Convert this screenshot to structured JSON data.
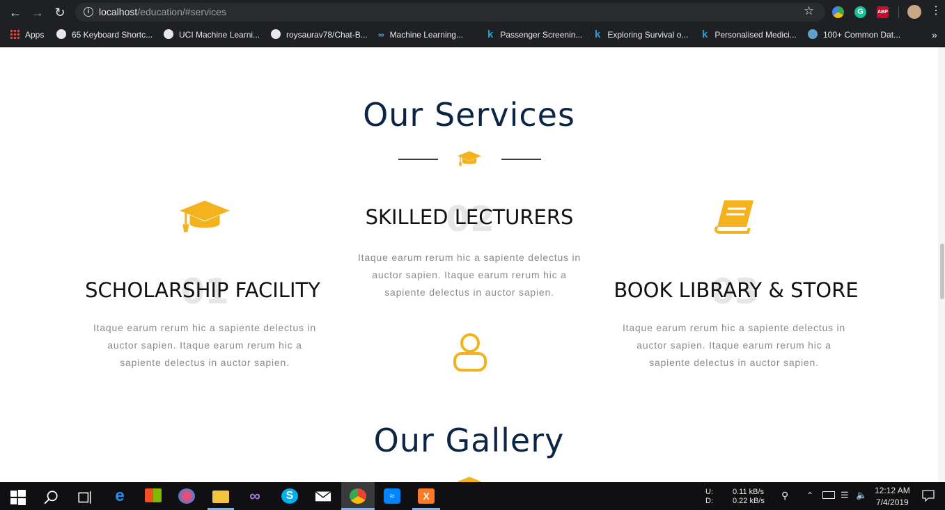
{
  "browser": {
    "url_host": "localhost",
    "url_path": "/education/#services",
    "bookmarks": [
      {
        "label": "Apps"
      },
      {
        "label": "65 Keyboard Shortc..."
      },
      {
        "label": "UCI Machine Learni..."
      },
      {
        "label": "roysaurav78/Chat-B..."
      },
      {
        "label": "Machine Learning..."
      },
      {
        "label": "Passenger Screenin..."
      },
      {
        "label": "Exploring Survival o..."
      },
      {
        "label": "Personalised Medici..."
      },
      {
        "label": "100+ Common Dat..."
      }
    ],
    "more_glyph": "»"
  },
  "services": {
    "title": "Our Services",
    "items": [
      {
        "number": "01",
        "title": "SCHOLARSHIP FACILITY",
        "text": "Itaque earum rerum hic a sapiente delectus in auctor sapien. Itaque earum rerum hic a sapiente delectus in auctor sapien.",
        "icon": "graduation-cap-icon"
      },
      {
        "number": "02",
        "title": "SKILLED LECTURERS",
        "text": "Itaque earum rerum hic a sapiente delectus in auctor sapien. Itaque earum rerum hic a sapiente delectus in auctor sapien.",
        "icon": "user-icon"
      },
      {
        "number": "03",
        "title": "BOOK LIBRARY & STORE",
        "text": "Itaque earum rerum hic a sapiente delectus in auctor sapien. Itaque earum rerum hic a sapiente delectus in auctor sapien.",
        "icon": "book-icon"
      }
    ]
  },
  "gallery": {
    "title": "Our Gallery"
  },
  "taskbar": {
    "net_up_label": "U:",
    "net_down_label": "D:",
    "net_up": "0.11 kB/s",
    "net_down": "0.22 kB/s",
    "time": "12:12 AM",
    "date": "7/4/2019"
  },
  "colors": {
    "accent": "#f5b21f",
    "heading": "#0d2544",
    "chrome": "#1f2023"
  }
}
